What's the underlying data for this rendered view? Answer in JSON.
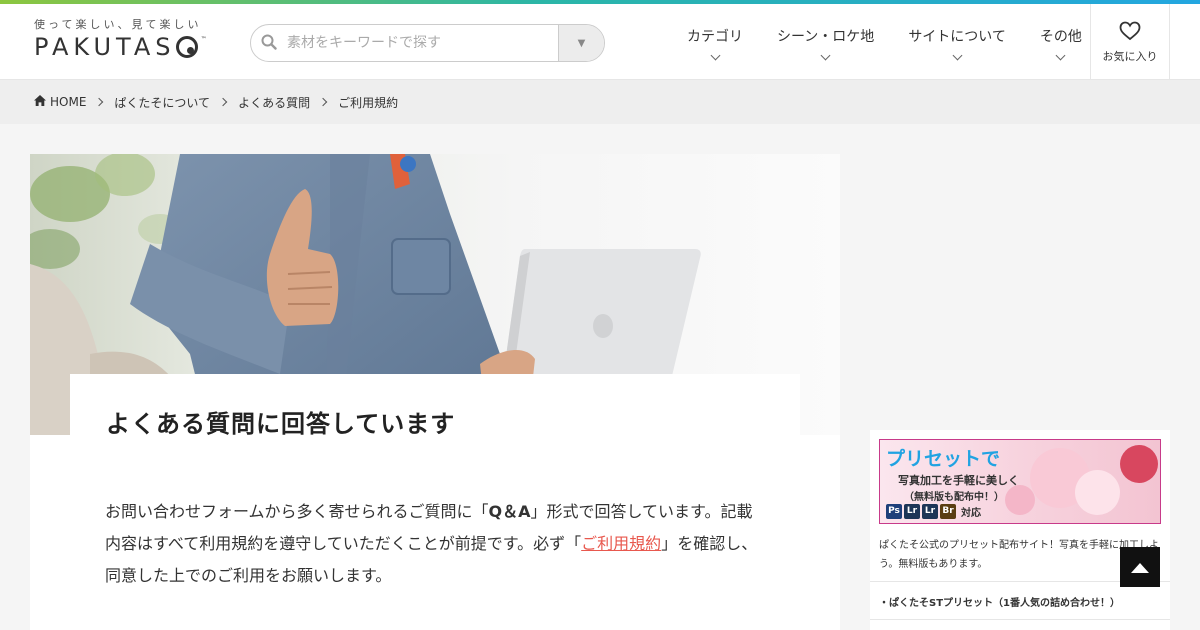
{
  "colors": {
    "accent": "#e8584e",
    "brand_blue": "#21a3e2",
    "gradient_start": "#8dc63f",
    "gradient_end": "#23a6e0"
  },
  "logo": {
    "tagline": "使って楽しい、見て楽しい",
    "wordmark": "PAKUTAS",
    "tm": "™"
  },
  "search": {
    "placeholder": "素材をキーワードで探す",
    "icon": "search-icon",
    "dropdown_icon": "caret-down-icon"
  },
  "nav": {
    "items": [
      {
        "label": "カテゴリ"
      },
      {
        "label": "シーン・ロケ地"
      },
      {
        "label": "サイトについて"
      },
      {
        "label": "その他"
      }
    ],
    "favorites_label": "お気に入り",
    "favorites_icon": "heart-icon"
  },
  "breadcrumb": {
    "home": "HOME",
    "items": [
      "ぱくたそについて",
      "よくある質問",
      "ご利用規約"
    ]
  },
  "main": {
    "title": "よくある質問に回答しています",
    "intro_pre": "お問い合わせフォームから多く寄せられるご質問に「",
    "intro_bold": "Q＆A",
    "intro_mid": "」形式で回答しています。記載内容はすべて利用規約を遵守していただくことが前提です。必ず「",
    "intro_link": "ご利用規約",
    "intro_post": "」を確認し、同意した上でのご利用をお願いします。"
  },
  "sidebar": {
    "banner": {
      "headline": "プリセットで",
      "line1": "写真加工を手軽に美しく",
      "line2": "（無料版も配布中！）",
      "badges": [
        "Ps",
        "Lr",
        "Lr",
        "Br"
      ],
      "badges_suffix": "対応"
    },
    "description": "ぱくたそ公式のプリセット配布サイト！写真を手軽に加工しよう。無料版もあります。",
    "link1": "・ぱくたそSTプリセット（1番人気の詰め合わせ！）"
  },
  "back_to_top_icon": "arrow-up-icon"
}
